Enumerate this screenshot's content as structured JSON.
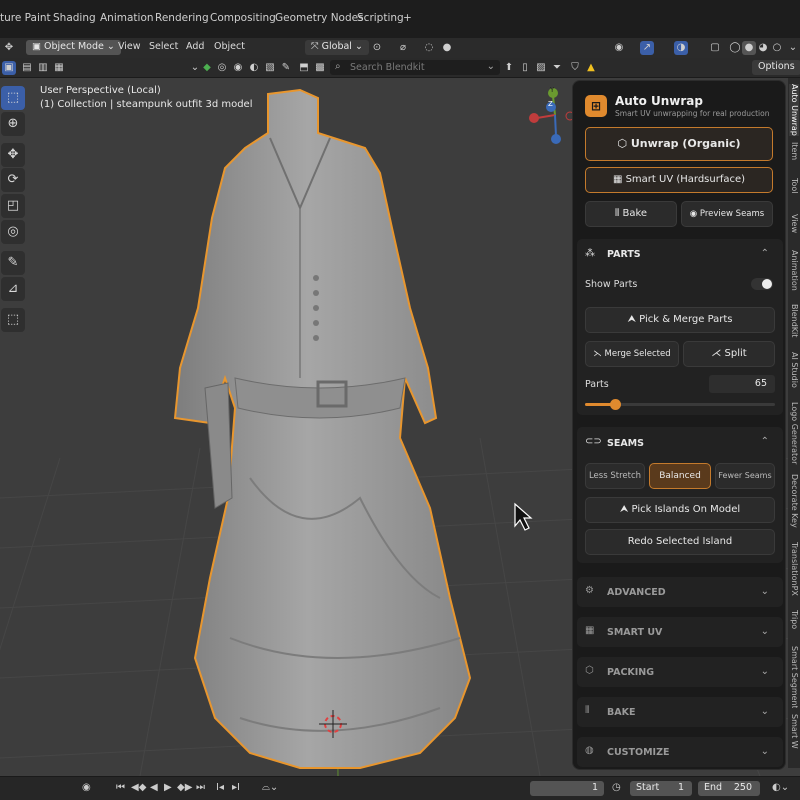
{
  "workspace_tabs": [
    "ture Paint",
    "Shading",
    "Animation",
    "Rendering",
    "Compositing",
    "Geometry Nodes",
    "Scripting",
    "+"
  ],
  "header": {
    "mode": "Object Mode",
    "menus": [
      "View",
      "Select",
      "Add",
      "Object"
    ],
    "transform": "Global",
    "search_placeholder": "Search Blendkit",
    "options": "Options"
  },
  "viewport": {
    "perspective": "User Perspective (Local)",
    "collection": "(1) Collection | steampunk outfit 3d model"
  },
  "gizmo": {
    "y": "Y",
    "z": "Z"
  },
  "panel": {
    "title": "Auto Unwrap",
    "subtitle": "Smart UV unwrapping for real production",
    "unwrap_organic": "Unwrap (Organic)",
    "smart_uv": "Smart UV (Hardsurface)",
    "bake": "Bake",
    "preview_seams": "Preview Seams",
    "parts": {
      "header": "PARTS",
      "show_parts": "Show Parts",
      "pick_merge": "Pick & Merge Parts",
      "merge_selected": "Merge Selected",
      "split": "Split",
      "parts_label": "Parts",
      "parts_value": "65",
      "slider_fraction": 0.16
    },
    "seams": {
      "header": "SEAMS",
      "less_stretch": "Less Stretch",
      "balanced": "Balanced",
      "fewer_seams": "Fewer Seams",
      "pick_islands": "Pick Islands On Model",
      "redo": "Redo Selected Island"
    },
    "collapsed": [
      "ADVANCED",
      "SMART UV",
      "PACKING",
      "BAKE",
      "CUSTOMIZE"
    ]
  },
  "side_tabs": [
    "Auto Unwrap",
    "Item",
    "Tool",
    "View",
    "Animation",
    "BlendKit",
    "AI Studio",
    "Logo Generator",
    "Decorate Key",
    "TranslationPX",
    "Tripo",
    "Smart Segment",
    "Smart W"
  ],
  "timeline": {
    "frame": "1",
    "start_label": "Start",
    "start": "1",
    "end_label": "End",
    "end": "250"
  },
  "colors": {
    "accent": "#e08a2e",
    "panel_bg": "#1a1a1a",
    "viewport_bg": "#3d3d3d"
  }
}
